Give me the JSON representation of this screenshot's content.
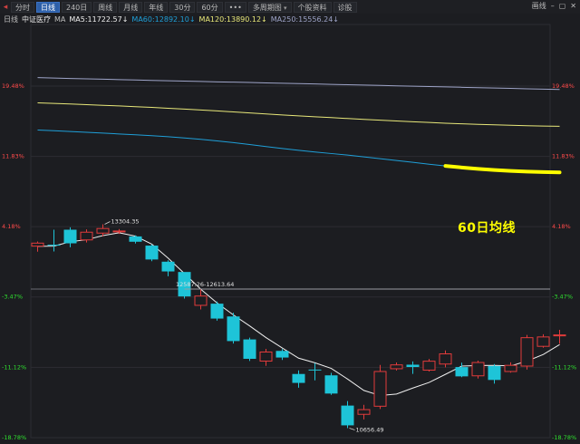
{
  "toolbar": {
    "tabs": [
      {
        "label": "分时",
        "active": false,
        "dropdown": false
      },
      {
        "label": "日线",
        "active": true,
        "dropdown": false
      },
      {
        "label": "240日",
        "active": false,
        "dropdown": false
      },
      {
        "label": "周线",
        "active": false,
        "dropdown": false
      },
      {
        "label": "月线",
        "active": false,
        "dropdown": false
      },
      {
        "label": "年线",
        "active": false,
        "dropdown": false
      },
      {
        "label": "30分",
        "active": false,
        "dropdown": false
      },
      {
        "label": "60分",
        "active": false,
        "dropdown": false
      },
      {
        "label": "•••",
        "active": false,
        "dropdown": false
      },
      {
        "label": "多周期图",
        "active": false,
        "dropdown": true
      },
      {
        "label": "个股资料",
        "active": false,
        "dropdown": false
      },
      {
        "label": "诊股",
        "active": false,
        "dropdown": false
      }
    ],
    "right": {
      "cleanup": "画线",
      "minimize": "–",
      "maximize": "▢",
      "close": "✕"
    }
  },
  "legend": {
    "period": "日线",
    "name": "中证医疗",
    "ma_label": "MA",
    "ma5": "MA5:11722.57↓",
    "ma60": "MA60:12892.10↓",
    "ma120": "MA120:13890.12↓",
    "ma250": "MA250:15556.24↓"
  },
  "colors": {
    "background": "#1c1d21",
    "grid": "#2c2d32",
    "up": "#e23b3b",
    "down": "#1ec4d8",
    "ma5": "#f0f0f0",
    "ma60": "#1f9fd8",
    "ma120": "#e8e87a",
    "ma250": "#9ea4c8",
    "highlight": "#ffff00",
    "positive_pct": "#ff4a4a",
    "negative_pct": "#2fe02f"
  },
  "chart_data": {
    "type": "candlestick",
    "y_axis_left": [
      "19.48%",
      "11.83%",
      "4.18%",
      "-3.47%",
      "-11.12%",
      "-18.78%"
    ],
    "y_axis_right": [
      "19.48%",
      "11.83%",
      "4.18%",
      "-3.47%",
      "-11.12%",
      "-18.78%"
    ],
    "ylim_pct": [
      -18.78,
      19.48
    ],
    "annotations": {
      "high": "13304.35",
      "low": "10656.49",
      "level": "12587.26-12613.64"
    },
    "handwritten_label": "60日均线",
    "candles": [
      {
        "o": 2.06,
        "c": 2.39,
        "h": 2.57,
        "l": 1.46
      },
      {
        "o": 2.22,
        "c": 2.22,
        "h": 3.85,
        "l": 1.48
      },
      {
        "o": 3.85,
        "c": 2.37,
        "h": 4.11,
        "l": 1.94
      },
      {
        "o": 2.74,
        "c": 3.58,
        "h": 3.89,
        "l": 2.46
      },
      {
        "o": 3.48,
        "c": 3.98,
        "h": 4.44,
        "l": 3.12
      },
      {
        "o": 3.67,
        "c": 3.71,
        "h": 3.92,
        "l": 3.4
      },
      {
        "o": 3.12,
        "c": 2.54,
        "h": 3.24,
        "l": 2.35
      },
      {
        "o": 2.12,
        "c": 0.61,
        "h": 2.25,
        "l": 0.42
      },
      {
        "o": 0.37,
        "c": -0.69,
        "h": 0.52,
        "l": -1.21
      },
      {
        "o": -0.75,
        "c": -3.41,
        "h": -1.07,
        "l": -3.64
      },
      {
        "o": -4.38,
        "c": -3.37,
        "h": -2.64,
        "l": -4.83
      },
      {
        "o": -4.2,
        "c": -5.82,
        "h": -3.96,
        "l": -6.05
      },
      {
        "o": -5.59,
        "c": -8.27,
        "h": -5.19,
        "l": -8.54
      },
      {
        "o": -8.09,
        "c": -10.2,
        "h": -7.9,
        "l": -10.43
      },
      {
        "o": -10.45,
        "c": -9.46,
        "h": -9.12,
        "l": -10.96
      },
      {
        "o": -9.34,
        "c": -10.06,
        "h": -9.13,
        "l": -10.33
      },
      {
        "o": -11.85,
        "c": -12.82,
        "h": -11.46,
        "l": -13.35
      },
      {
        "o": -11.37,
        "c": -11.37,
        "h": -10.67,
        "l": -12.54
      },
      {
        "o": -12.0,
        "c": -13.98,
        "h": -11.73,
        "l": -14.12
      },
      {
        "o": -15.29,
        "c": -17.44,
        "h": -14.8,
        "l": -17.74
      },
      {
        "o": -16.24,
        "c": -15.73,
        "h": -15.2,
        "l": -16.8
      },
      {
        "o": -15.36,
        "c": -11.58,
        "h": -10.87,
        "l": -15.66
      },
      {
        "o": -11.28,
        "c": -10.86,
        "h": -10.6,
        "l": -11.47
      },
      {
        "o": -10.84,
        "c": -11.09,
        "h": -10.49,
        "l": -11.84
      },
      {
        "o": -11.43,
        "c": -10.46,
        "h": -10.21,
        "l": -11.58
      },
      {
        "o": -10.77,
        "c": -9.66,
        "h": -9.29,
        "l": -11.13
      },
      {
        "o": -11.1,
        "c": -12.11,
        "h": -10.62,
        "l": -12.2
      },
      {
        "o": -12.05,
        "c": -10.6,
        "h": -10.4,
        "l": -12.35
      },
      {
        "o": -10.98,
        "c": -12.5,
        "h": -10.77,
        "l": -12.9
      },
      {
        "o": -11.58,
        "c": -10.91,
        "h": -10.58,
        "l": -11.7
      },
      {
        "o": -10.99,
        "c": -7.9,
        "h": -7.6,
        "l": -11.37
      },
      {
        "o": -8.84,
        "c": -7.82,
        "h": -7.53,
        "l": -8.99
      },
      {
        "o": -7.7,
        "c": -7.6,
        "h": -7.04,
        "l": -8.56
      }
    ],
    "ma5": [
      2.04,
      2.06,
      2.54,
      2.76,
      3.21,
      3.52,
      3.15,
      2.28,
      0.76,
      -0.92,
      -2.62,
      -4.12,
      -5.42,
      -6.62,
      -7.89,
      -9.02,
      -10.13,
      -10.63,
      -11.24,
      -12.4,
      -13.64,
      -14.2,
      -14.03,
      -13.38,
      -12.77,
      -11.89,
      -10.99,
      -10.93,
      -10.92,
      -10.97,
      -10.45,
      -9.73,
      -8.65
    ],
    "ma60": [
      14.7,
      14.62,
      14.54,
      14.45,
      14.36,
      14.27,
      14.18,
      14.08,
      13.97,
      13.84,
      13.69,
      13.52,
      13.33,
      13.12,
      12.9,
      12.69,
      12.49,
      12.31,
      12.14,
      11.97,
      11.78,
      11.58,
      11.38,
      11.18,
      10.98,
      10.79,
      10.62,
      10.47,
      10.35,
      10.25,
      10.17,
      10.12,
      10.09
    ],
    "ma120": [
      17.65,
      17.59,
      17.53,
      17.46,
      17.39,
      17.32,
      17.24,
      17.16,
      17.07,
      16.98,
      16.88,
      16.78,
      16.67,
      16.56,
      16.45,
      16.34,
      16.24,
      16.14,
      16.05,
      15.95,
      15.86,
      15.77,
      15.68,
      15.6,
      15.52,
      15.44,
      15.37,
      15.31,
      15.26,
      15.21,
      15.17,
      15.13,
      15.1
    ],
    "ma250": [
      20.4,
      20.36,
      20.31,
      20.27,
      20.23,
      20.18,
      20.14,
      20.1,
      20.06,
      20.02,
      19.98,
      19.94,
      19.91,
      19.87,
      19.83,
      19.79,
      19.75,
      19.71,
      19.67,
      19.63,
      19.59,
      19.55,
      19.51,
      19.47,
      19.43,
      19.39,
      19.35,
      19.31,
      19.27,
      19.23,
      19.19,
      19.15,
      19.11
    ]
  }
}
